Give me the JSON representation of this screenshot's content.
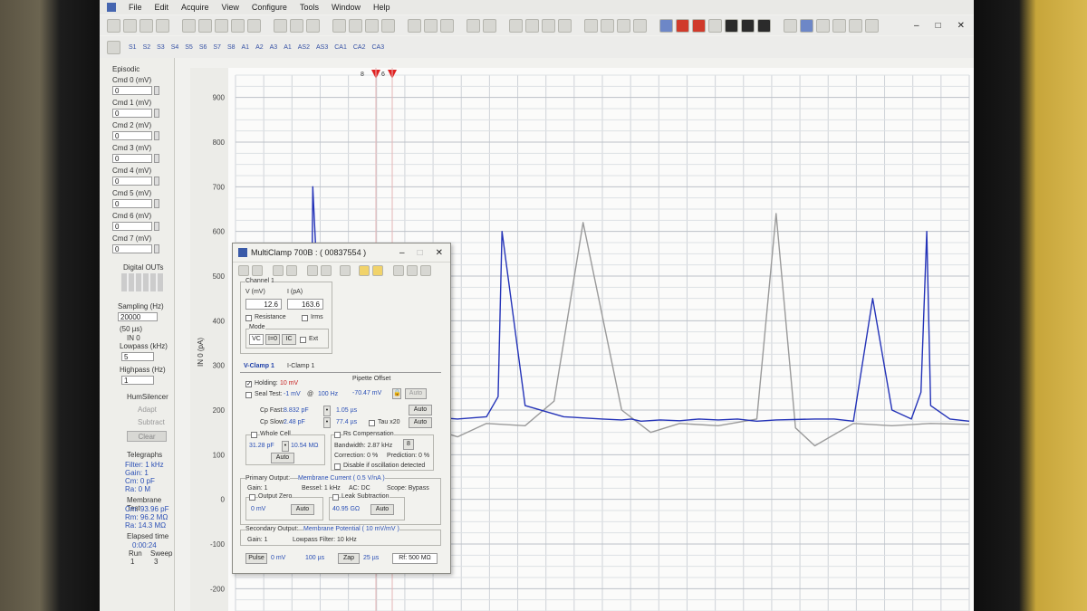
{
  "menu": [
    "File",
    "Edit",
    "Acquire",
    "View",
    "Configure",
    "Tools",
    "Window",
    "Help"
  ],
  "signals": [
    "S1",
    "S2",
    "S3",
    "S4",
    "S5",
    "S6",
    "S7",
    "S8",
    "A1",
    "A2",
    "A3",
    "A1",
    "AS2",
    "AS3",
    "CA1",
    "CA2",
    "CA3"
  ],
  "sidebar": {
    "episodic": "Episodic",
    "cmds": [
      {
        "label": "Cmd 0 (mV)",
        "value": "0"
      },
      {
        "label": "Cmd 1 (mV)",
        "value": "0"
      },
      {
        "label": "Cmd 2 (mV)",
        "value": "0"
      },
      {
        "label": "Cmd 3 (mV)",
        "value": "0"
      },
      {
        "label": "Cmd 4 (mV)",
        "value": "0"
      },
      {
        "label": "Cmd 5 (mV)",
        "value": "0"
      },
      {
        "label": "Cmd 6 (mV)",
        "value": "0"
      },
      {
        "label": "Cmd 7 (mV)",
        "value": "0"
      }
    ],
    "digital_outs": "Digital OUTs",
    "sampling_label": "Sampling (Hz)",
    "sampling_value": "20000",
    "sampling_period": "(50 µs)",
    "in0": "IN 0",
    "lowpass_label": "Lowpass (kHz)",
    "lowpass_value": "5",
    "highpass_label": "Highpass (Hz)",
    "highpass_value": "1",
    "humsilencer": "HumSilencer",
    "adapt": "Adapt",
    "subtract": "Subtract",
    "clear": "Clear",
    "telegraphs": "Telegraphs",
    "telegraph_lines": [
      "Filter: 1 kHz",
      "Gain: 1",
      "Cm: 0 pF",
      "Ra: 0 M"
    ],
    "membrane_test": "Membrane Test",
    "mt_lines": [
      "Cm: 93.96 pF",
      "Rm: 96.2 MΩ",
      "Ra: 14.3 MΩ"
    ],
    "elapsed_label": "Elapsed time",
    "elapsed_value": "0:00:24",
    "run_label": "Run",
    "sweep_label": "Sweep",
    "run_value": "1",
    "sweep_value": "3"
  },
  "plot": {
    "y_ticks": [
      "900",
      "800",
      "700",
      "600",
      "500",
      "400",
      "300",
      "200",
      "100",
      "0",
      "-100",
      "-200"
    ],
    "channel_label": "IN 0 (pA)",
    "cursor_labels": [
      "8",
      "6"
    ]
  },
  "chart_data": {
    "type": "line",
    "ylabel": "IN 0 (pA)",
    "ylim": [
      -250,
      950
    ],
    "series": [
      {
        "values_description_free": true,
        "color": "#2433b8",
        "x": [
          0,
          20,
          40,
          60,
          70,
          78,
          80,
          90,
          110,
          140,
          160,
          175,
          178,
          182,
          200,
          230,
          260,
          272,
          276,
          300,
          340,
          380,
          400,
          410,
          420,
          440,
          460,
          480,
          500,
          520,
          540,
          560,
          600,
          620,
          640,
          660,
          680,
          700,
          710,
          716,
          720,
          740,
          760
        ],
        "values": [
          180,
          175,
          178,
          172,
          175,
          200,
          700,
          250,
          190,
          180,
          175,
          200,
          560,
          200,
          185,
          180,
          185,
          230,
          600,
          210,
          185,
          180,
          178,
          180,
          175,
          178,
          176,
          180,
          178,
          180,
          175,
          178,
          180,
          180,
          175,
          450,
          200,
          180,
          240,
          600,
          210,
          180,
          175
        ]
      },
      {
        "color": "#9a9a9a",
        "x": [
          0,
          40,
          80,
          120,
          160,
          200,
          230,
          260,
          300,
          330,
          360,
          400,
          430,
          460,
          500,
          540,
          560,
          580,
          600,
          640,
          680,
          720,
          760
        ],
        "values": [
          170,
          168,
          172,
          160,
          165,
          160,
          140,
          170,
          165,
          220,
          620,
          200,
          150,
          170,
          165,
          180,
          640,
          160,
          120,
          170,
          165,
          170,
          168
        ]
      }
    ]
  },
  "dialog": {
    "title": "MultiClamp 700B : ( 00837554 )",
    "channel": "Channel 1",
    "v_label": "V (mV)",
    "i_label": "I (pA)",
    "v_value": "12.6",
    "i_value": "163.6",
    "resistance": "Resistance",
    "irms": "Irms",
    "mode": "Mode",
    "modes": [
      "VC",
      "I=0",
      "IC",
      "Ext"
    ],
    "tabs": [
      "V-Clamp 1",
      "I-Clamp 1"
    ],
    "holding_label": "Holding:",
    "holding_value": "10 mV",
    "seal_label": "Seal Test:",
    "seal_value": "-1 mV",
    "seal_at": "@",
    "seal_freq": "100 Hz",
    "pipette_offset": "Pipette Offset",
    "pipette_value": "-70.47 mV",
    "auto": "Auto",
    "cp_fast_label": "Cp Fast:",
    "cp_fast_pf": "8.832 pF",
    "cp_fast_us": "1.05 µs",
    "cp_slow_label": "Cp Slow:",
    "cp_slow_pf": "2.48 pF",
    "cp_slow_us": "77.4 µs",
    "tau": "Tau x20",
    "whole_cell": "Whole Cell",
    "wc_pf": "31.28 pF",
    "wc_mohm": "10.54 MΩ",
    "rs_comp": "Rs Compensation",
    "bandwidth": "Bandwidth: 2.87 kHz",
    "correction": "Correction: 0 %",
    "prediction": "Prediction: 0 %",
    "disable_osc": "Disable if oscillation detected",
    "primary": "Primary Output:",
    "primary_val": "Membrane Current ( 0.5 V/nA )",
    "gain1": "Gain: 1",
    "bessel": "Bessel: 1 kHz",
    "ac": "AC: DC",
    "scope": "Scope: Bypass",
    "output_zero": "Output Zero",
    "oz_val": "0 mV",
    "leak_sub": "Leak Subtraction",
    "leak_val": "40.95 GΩ",
    "secondary": "Secondary Output:",
    "secondary_val": "Membrane Potential ( 10 mV/mV )",
    "gain2": "Gain: 1",
    "lowpass2": "Lowpass Filter: 10 kHz",
    "pulse": "Pulse",
    "pulse_mv": "0 mV",
    "pulse_us": "100 µs",
    "zap": "Zap",
    "zap_us": "25 µs",
    "rf": "Rf: 500 MΩ"
  }
}
